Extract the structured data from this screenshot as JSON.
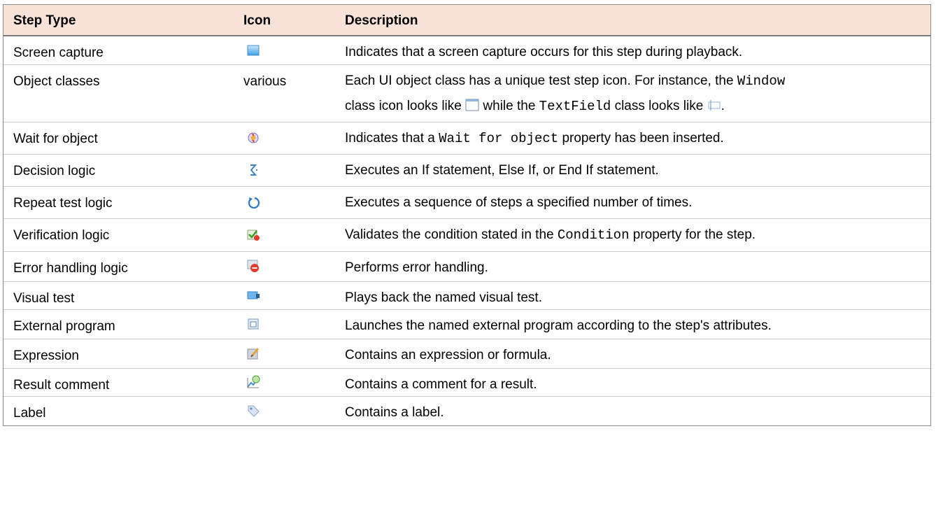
{
  "header": {
    "step_type": "Step Type",
    "icon": "Icon",
    "description": "Description"
  },
  "rows": [
    {
      "step": "Screen capture",
      "icon": "screen-capture-icon",
      "desc": "Indicates that a screen capture occurs for this step during playback."
    },
    {
      "step": "Object classes",
      "icon_text": "various",
      "desc_a": "Each UI object class has a unique test step icon. For instance, the ",
      "desc_code1": "Window",
      "desc_b": "class icon looks like ",
      "desc_c": " while the ",
      "desc_code2": "TextField",
      "desc_d": " class looks like ",
      "desc_e": "."
    },
    {
      "step": "Wait for object",
      "icon": "wait-for-object-icon",
      "desc_a": "Indicates that a ",
      "desc_code": "Wait for object",
      "desc_b": " property has been inserted."
    },
    {
      "step": "Decision logic",
      "icon": "decision-logic-icon",
      "desc": "Executes an If statement, Else If, or End If statement."
    },
    {
      "step": "Repeat test logic",
      "icon": "repeat-icon",
      "desc": "Executes a sequence of steps a specified number of times."
    },
    {
      "step": "Verification logic",
      "icon": "verification-icon",
      "desc_a": "Validates the condition stated in the ",
      "desc_code": "Condition",
      "desc_b": " property for the step."
    },
    {
      "step": "Error handling logic",
      "icon": "error-handling-icon",
      "desc": "Performs error handling."
    },
    {
      "step": "Visual test",
      "icon": "visual-test-icon",
      "desc": "Plays back the named visual test."
    },
    {
      "step": "External program",
      "icon": "external-program-icon",
      "desc": "Launches the named external program according to the step's attributes."
    },
    {
      "step": "Expression",
      "icon": "expression-icon",
      "desc": "Contains an expression or formula."
    },
    {
      "step": "Result comment",
      "icon": "result-comment-icon",
      "desc": "Contains a comment for a result."
    },
    {
      "step": "Label",
      "icon": "label-icon",
      "desc": "Contains a label."
    }
  ]
}
